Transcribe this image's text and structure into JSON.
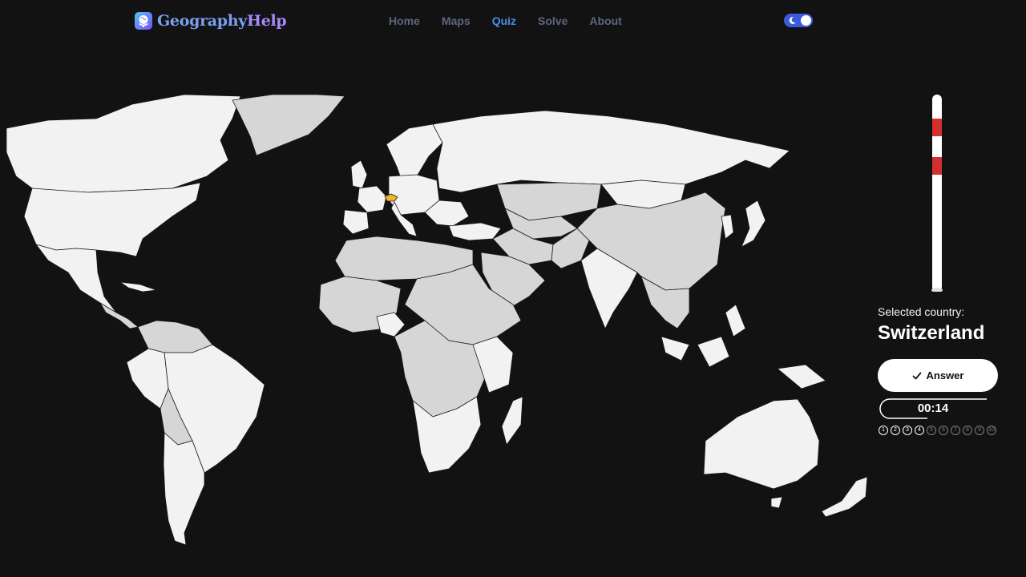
{
  "brand": {
    "name_part1": "Geography",
    "name_part2": "Help"
  },
  "nav": {
    "items": [
      {
        "label": "Home",
        "active": false
      },
      {
        "label": "Maps",
        "active": false
      },
      {
        "label": "Quiz",
        "active": true
      },
      {
        "label": "Solve",
        "active": false
      },
      {
        "label": "About",
        "active": false
      }
    ]
  },
  "theme": {
    "mode": "dark"
  },
  "quiz": {
    "selected_label": "Selected country:",
    "selected_country": "Switzerland",
    "answer_label": "Answer",
    "timer": "00:14",
    "questions": [
      "1",
      "2",
      "3",
      "4",
      "5",
      "6",
      "7",
      "8",
      "9",
      "10"
    ],
    "answered_count": 4
  },
  "colors": {
    "background": "#121212",
    "land_light": "#f2f2f2",
    "land_gray": "#d6d6d6",
    "selected": "#f0b429",
    "accent": "#4a90e2",
    "pole_red": "#d32f2f"
  }
}
